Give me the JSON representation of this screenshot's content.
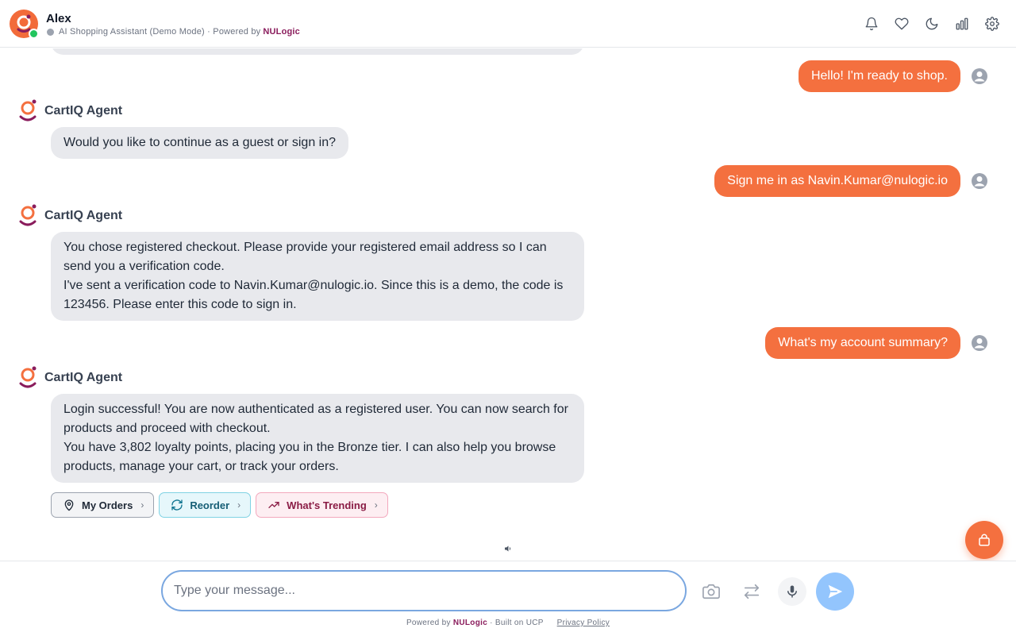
{
  "header": {
    "title": "Alex",
    "subtitle_prefix": "AI Shopping Assistant (Demo Mode) · Powered by",
    "subtitle_brand": "NULogic",
    "icons": [
      "bell-icon",
      "heart-icon",
      "moon-icon",
      "bar-chart-icon",
      "gear-icon"
    ]
  },
  "messages": [
    {
      "role": "user",
      "text": "Hello! I'm ready to shop."
    },
    {
      "role": "agent",
      "name": "CartIQ Agent",
      "text": "Would you like to continue as a guest or sign in?"
    },
    {
      "role": "user",
      "text": "Sign me in as Navin.Kumar@nulogic.io"
    },
    {
      "role": "agent",
      "name": "CartIQ Agent",
      "lines": [
        "You chose registered checkout. Please provide your registered email address so I can send you a verification code.",
        "I've sent a verification code to Navin.Kumar@nulogic.io. Since this is a demo, the code is 123456. Please enter this code to sign in."
      ]
    },
    {
      "role": "user",
      "text": "What's my account summary?"
    },
    {
      "role": "agent",
      "name": "CartIQ Agent",
      "lines": [
        "Login successful! You are now authenticated as a registered user. You can now search for products and proceed with checkout.",
        "You have 3,802 loyalty points, placing you in the Bronze tier. I can also help you browse products, manage your cart, or track your orders."
      ]
    }
  ],
  "quick_actions": [
    {
      "label": "My Orders",
      "icon": "location-pin-icon"
    },
    {
      "label": "Reorder",
      "icon": "refresh-icon"
    },
    {
      "label": "What's Trending",
      "icon": "trending-up-icon"
    }
  ],
  "composer": {
    "placeholder": "Type your message...",
    "value": ""
  },
  "footer": {
    "powered_prefix": "Powered by",
    "brand": "NULogic",
    "built_on": "· Built on UCP",
    "privacy_link": "Privacy Policy"
  },
  "colors": {
    "accent": "#f4703f",
    "brand": "#8a1c5c",
    "agent_bubble": "#e8e9ed",
    "send_button": "#93c5fd"
  }
}
